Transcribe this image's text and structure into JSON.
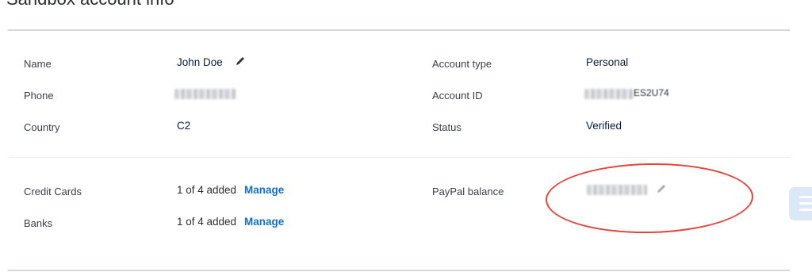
{
  "page": {
    "title": "Sandbox account info"
  },
  "profile": {
    "name_label": "Name",
    "name_value": "John Doe",
    "phone_label": "Phone",
    "country_label": "Country",
    "country_value": "C2",
    "account_type_label": "Account type",
    "account_type_value": "Personal",
    "account_id_label": "Account ID",
    "account_id_visible": "ES2U74",
    "status_label": "Status",
    "status_value": "Verified"
  },
  "funding": {
    "credit_cards_label": "Credit Cards",
    "credit_cards_value": "1 of 4 added",
    "banks_label": "Banks",
    "banks_value": "1 of 4 added",
    "manage_label": "Manage",
    "balance_label": "PayPal balance"
  },
  "colors": {
    "link": "#1070c9",
    "annotation": "#e8423a",
    "text": "#0b1d3a"
  }
}
